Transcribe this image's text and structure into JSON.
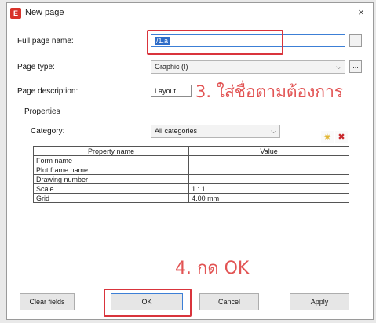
{
  "window": {
    "title": "New page",
    "app_icon": "eplan-app-icon",
    "close_glyph": "×"
  },
  "form": {
    "full_page_name_label": "Full page name:",
    "full_page_name_value": "/1.a",
    "browse_glyph": "...",
    "page_type_label": "Page type:",
    "page_type_value": "Graphic (I)",
    "page_description_label": "Page description:",
    "page_description_value": "Layout",
    "properties_label": "Properties",
    "category_label": "Category:",
    "category_value": "All categories"
  },
  "annotations": {
    "step3": "3. ใส่ชื่อตามต้องการ",
    "step4": "4. กด OK",
    "color": "#e25454"
  },
  "table": {
    "headers": [
      "Property name",
      "Value"
    ],
    "rows": [
      {
        "name": "Form name",
        "value": ""
      },
      {
        "name": "Plot frame name",
        "value": ""
      },
      {
        "name": "Drawing number",
        "value": ""
      },
      {
        "name": "Scale",
        "value": "1 : 1"
      },
      {
        "name": "Grid",
        "value": "4.00 mm"
      }
    ]
  },
  "buttons": {
    "clear_fields": "Clear fields",
    "ok": "OK",
    "cancel": "Cancel",
    "apply": "Apply"
  },
  "tool_icons": {
    "new": "✷",
    "delete": "✖"
  }
}
